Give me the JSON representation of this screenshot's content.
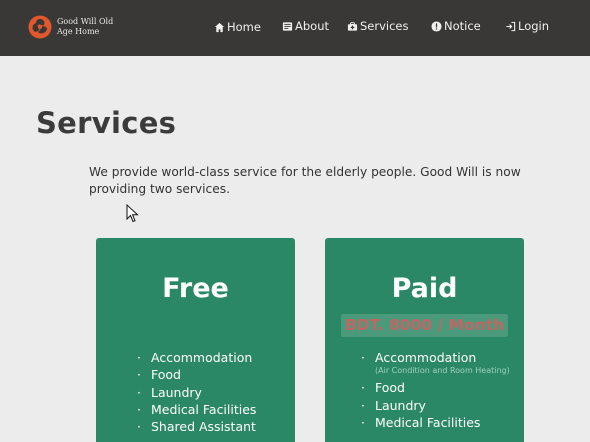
{
  "brand": {
    "name_line1": "Good Will Old",
    "name_line2": "Age Home",
    "logo_color": "#e2572b"
  },
  "nav": {
    "home": "Home",
    "about": "About",
    "services": "Services",
    "notice": "Notice",
    "login": "Login"
  },
  "page": {
    "title": "Services",
    "intro": "We provide world-class service for the elderly people. Good Will is now providing two services."
  },
  "cards": {
    "free": {
      "title": "Free",
      "features": [
        "Accommodation",
        "Food",
        "Laundry",
        "Medical Facilities",
        "Shared Assistant"
      ]
    },
    "paid": {
      "title": "Paid",
      "price": "BDT. 8000 / Month",
      "features": [
        {
          "label": "Accommodation",
          "note": "(Air Condition and Room Heating)"
        },
        {
          "label": "Food"
        },
        {
          "label": "Laundry"
        },
        {
          "label": "Medical Facilities"
        }
      ]
    }
  },
  "colors": {
    "navbar": "#3a3836",
    "card": "#2b8867",
    "price_text": "#c36564",
    "background": "#ececec"
  }
}
